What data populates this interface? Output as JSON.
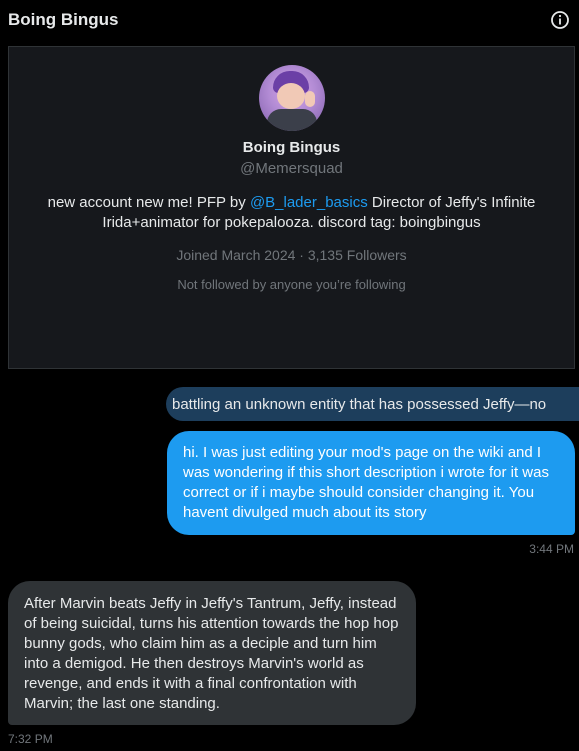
{
  "header": {
    "title": "Boing Bingus",
    "info_icon": "info-icon"
  },
  "profile": {
    "display_name": "Boing Bingus",
    "handle": "@Memersquad",
    "bio_prefix": "new account new me! PFP by ",
    "bio_mention": "@B_lader_basics",
    "bio_suffix": " Director of Jeffy's Infinite Irida+animator for pokepalooza. discord tag: boingbingus",
    "meta": "Joined March 2024 · 3,135 Followers",
    "followed_note": "Not followed by anyone you’re following"
  },
  "messages": [
    {
      "direction": "sent",
      "text": "battling an unknown entity that has possessed Jeffy—no"
    },
    {
      "direction": "sent",
      "text": "hi. I was just editing your mod's page on the wiki and I was wondering if this short description i wrote for it was correct or if i maybe should consider changing it. You havent divulged much about its story",
      "time": "3:44 PM"
    },
    {
      "direction": "received",
      "text": "After Marvin beats Jeffy in Jeffy's Tantrum, Jeffy, instead of being suicidal, turns his attention towards the hop hop bunny gods, who claim him as a deciple and turn him into a demigod. He then destroys Marvin's world as revenge, and  ends it with a final confrontation with Marvin; the last one standing.",
      "time": "7:32 PM"
    }
  ],
  "colors": {
    "background": "#000000",
    "card": "#16181c",
    "accent": "#1d9bf0",
    "received_bubble": "#2f3336",
    "muted_text": "#71767b"
  }
}
